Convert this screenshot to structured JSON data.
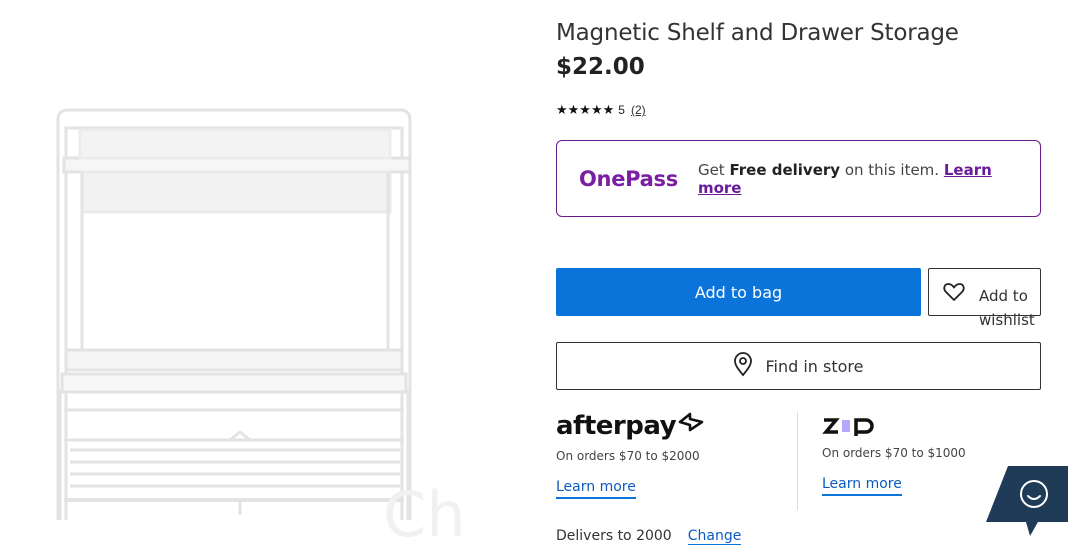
{
  "product": {
    "title": "Magnetic Shelf and Drawer Storage",
    "price": "$22.00",
    "rating_stars": "★★★★★",
    "rating_value": "5",
    "review_count": "(2)",
    "image_watermark": "Ch"
  },
  "onepass": {
    "logo": "OnePass",
    "text_prefix": "Get ",
    "text_bold": "Free delivery",
    "text_suffix": " on this item. ",
    "learn_more": "Learn more"
  },
  "actions": {
    "add_to_bag": "Add to bag",
    "add_to_wishlist": "Add to wishlist",
    "find_in_store": "Find in store"
  },
  "payments": {
    "afterpay": {
      "logo": "afterpay",
      "note": "On orders $70 to $2000",
      "learn_more": "Learn more"
    },
    "zip": {
      "logo": "zip",
      "note": "On orders $70 to $1000",
      "learn_more": "Learn more"
    }
  },
  "delivery": {
    "text": "Delivers to 2000",
    "change": "Change"
  },
  "colors": {
    "accent_blue": "#0a74da",
    "onepass_purple": "#7b1fa2",
    "chat_navy": "#1f3b57"
  },
  "icons": [
    "heart-icon",
    "location-pin-icon",
    "afterpay-loop-icon",
    "chat-icon"
  ]
}
